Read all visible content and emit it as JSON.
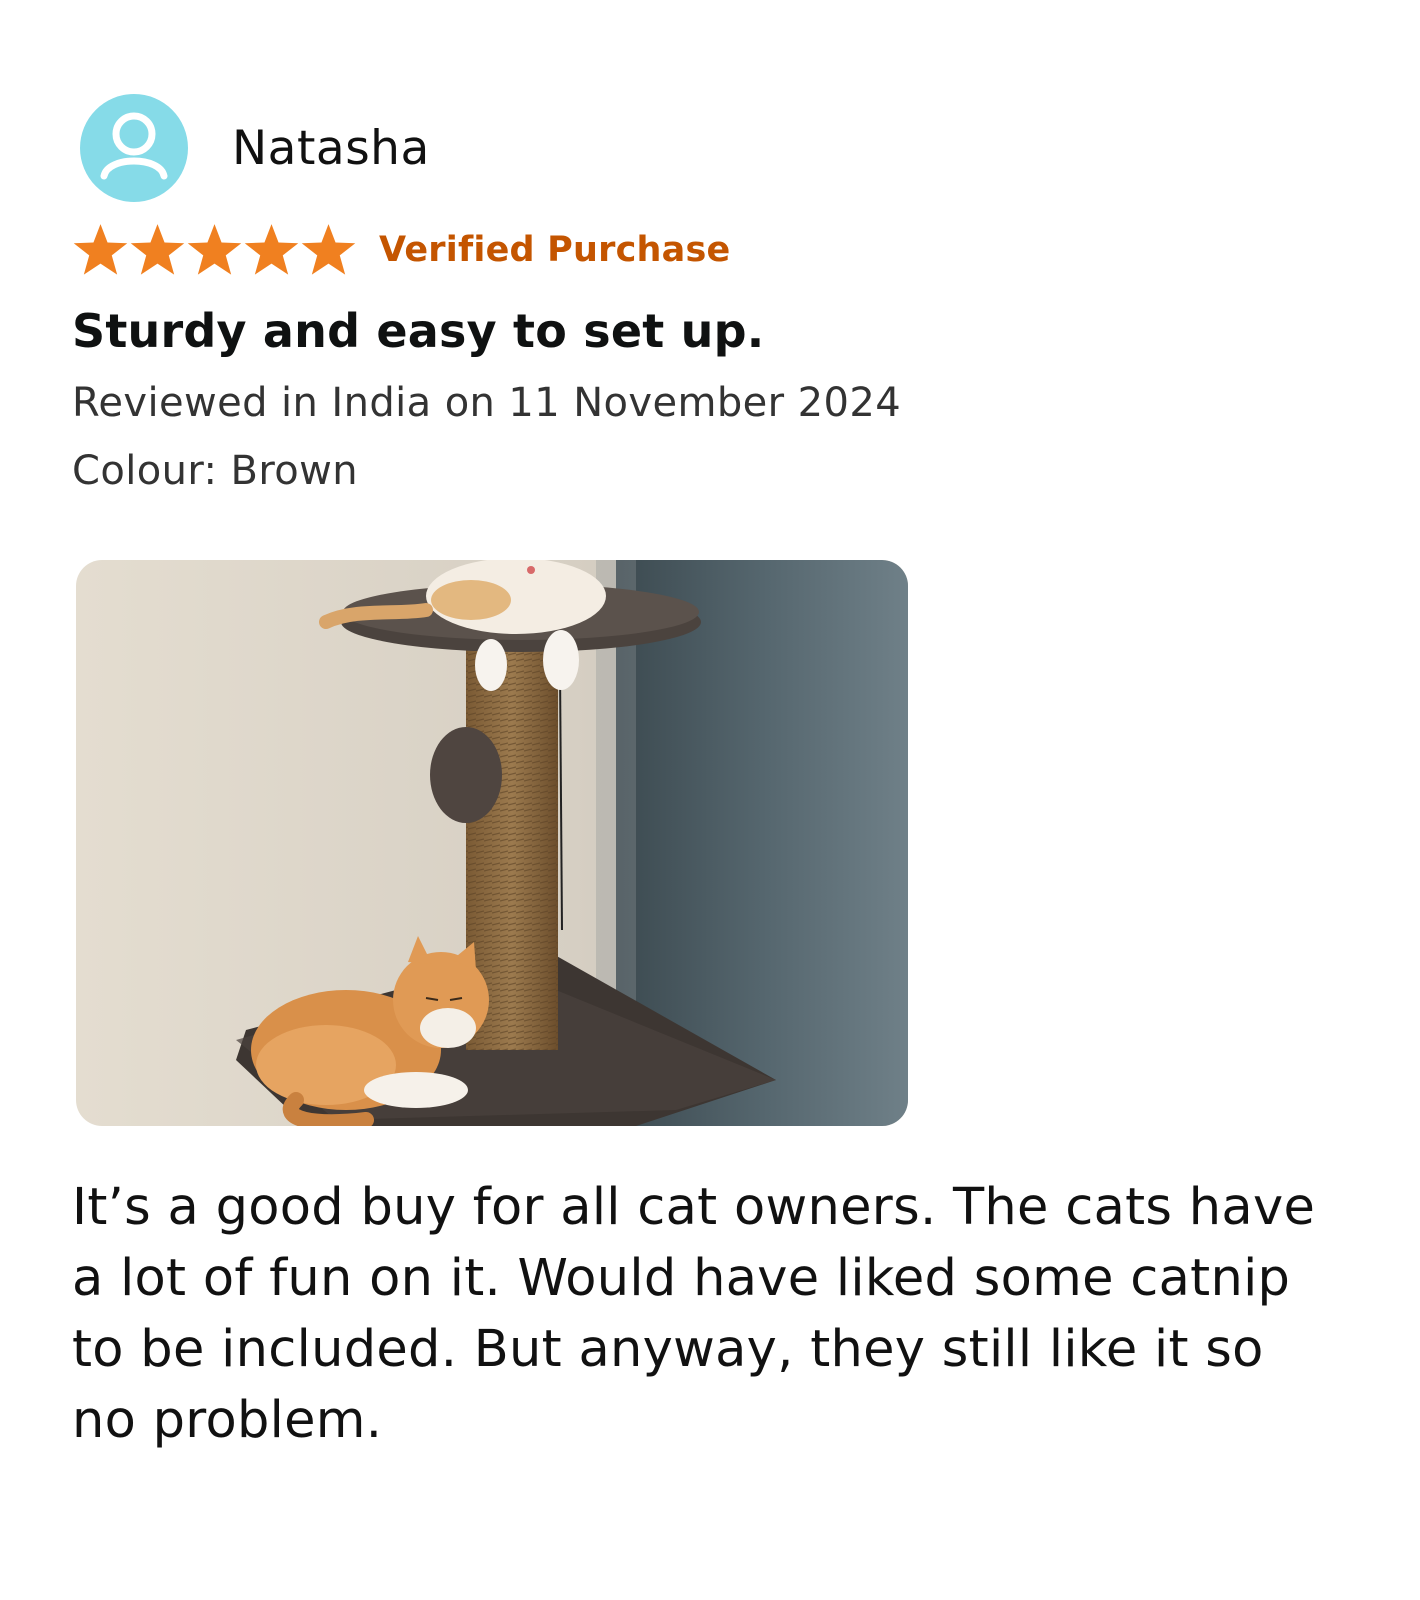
{
  "review": {
    "reviewer_name": "Natasha",
    "rating": 5,
    "rating_max": 5,
    "verified_label": "Verified Purchase",
    "title": "Sturdy and easy to set up.",
    "meta": "Reviewed in India on 11 November 2024",
    "colour": "Colour: Brown",
    "body": "It’s a good buy for all cat owners. The cats have a lot of fun on it. Would have liked some catnip to be included. But anyway, they still like it so no problem."
  },
  "colors": {
    "star": "#f08020",
    "verified": "#c45500",
    "avatar_bg": "#86dbe8"
  },
  "icons": {
    "avatar": "user-icon",
    "star": "star-icon"
  }
}
